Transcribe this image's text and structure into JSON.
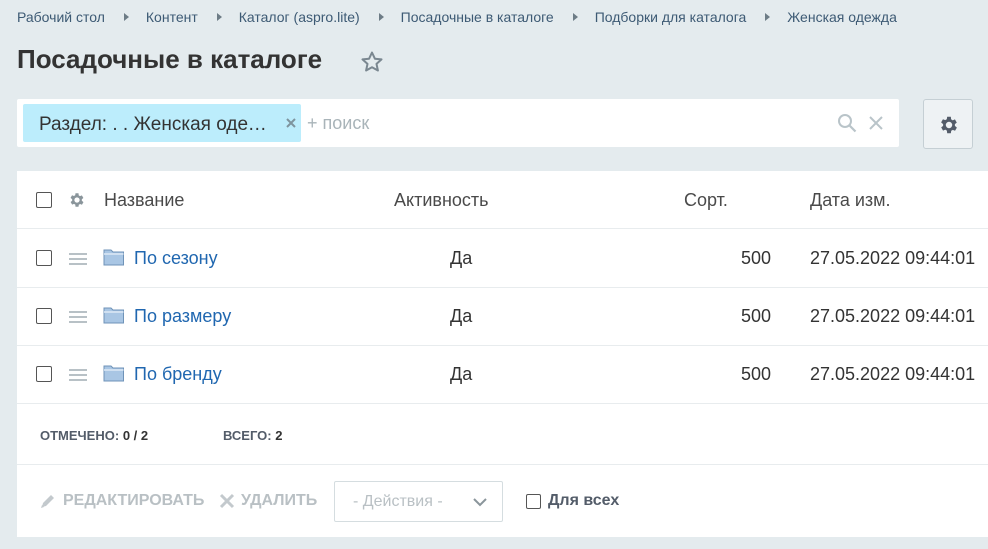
{
  "breadcrumb": [
    "Рабочий стол",
    "Контент",
    "Каталог (aspro.lite)",
    "Посадочные в каталоге",
    "Подборки для каталога",
    "Женская одежда"
  ],
  "page": {
    "title": "Посадочные в каталоге"
  },
  "filter": {
    "chip_label": "Раздел: . . Женская одежда",
    "search_placeholder": "+ поиск"
  },
  "table": {
    "columns": {
      "name": "Название",
      "activity": "Активность",
      "sort": "Сорт.",
      "date": "Дата изм."
    },
    "rows": [
      {
        "name": "По сезону",
        "activity": "Да",
        "sort": "500",
        "date": "27.05.2022 09:44:01"
      },
      {
        "name": "По размеру",
        "activity": "Да",
        "sort": "500",
        "date": "27.05.2022 09:44:01"
      },
      {
        "name": "По бренду",
        "activity": "Да",
        "sort": "500",
        "date": "27.05.2022 09:44:01"
      }
    ]
  },
  "footer": {
    "selected_label": "Отмечено:",
    "selected_value": "0 / 2",
    "total_label": "Всего:",
    "total_value": "2"
  },
  "actions": {
    "edit": "Редактировать",
    "delete": "Удалить",
    "select_label": "- Действия -",
    "for_all": "Для всех"
  },
  "icons": {
    "star": "star-outline-icon",
    "gear": "gear-icon",
    "search": "search-icon",
    "clear": "close-icon",
    "folder": "folder-icon",
    "drag": "drag-handle-icon"
  },
  "colors": {
    "background": "#e4ebee",
    "chip": "#bcedfc",
    "link": "#2067b0",
    "disabled": "#b9c0c4"
  }
}
